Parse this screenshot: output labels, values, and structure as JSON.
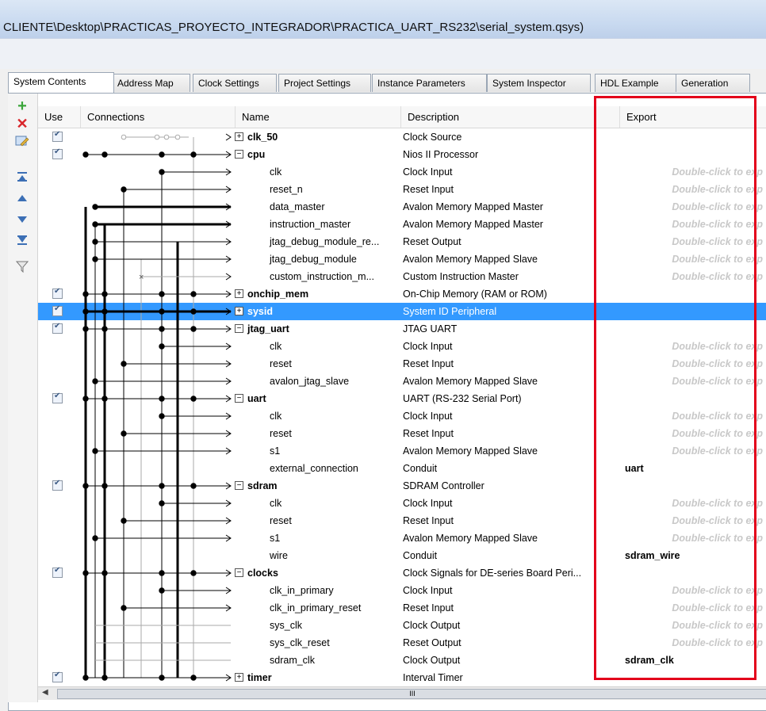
{
  "window": {
    "title": "CLIENTE\\Desktop\\PRACTICAS_PROYECTO_INTEGRADOR\\PRACTICA_UART_RS232\\serial_system.qsys)"
  },
  "tabs": [
    {
      "label": "System Contents"
    },
    {
      "label": "Address Map"
    },
    {
      "label": "Clock Settings"
    },
    {
      "label": "Project Settings"
    },
    {
      "label": "Instance Parameters"
    },
    {
      "label": "System Inspector"
    },
    {
      "label": "HDL Example"
    },
    {
      "label": "Generation"
    }
  ],
  "toolbar": {
    "icons": [
      "add-icon",
      "remove-icon",
      "edit-icon",
      "move-top-icon",
      "move-up-icon",
      "move-down-icon",
      "move-bottom-icon",
      "filter-icon"
    ],
    "colors": {
      "add": "#3aa53a",
      "remove": "#d9262b",
      "arrows": "#3c6fb5"
    }
  },
  "columns": {
    "use": "Use",
    "connections": "Connections",
    "name": "Name",
    "description": "Description",
    "export": "Export"
  },
  "rows": [
    {
      "type": "main",
      "expanded": false,
      "name": "clk_50",
      "desc": "Clock Source",
      "export": ""
    },
    {
      "type": "main",
      "expanded": true,
      "name": "cpu",
      "desc": "Nios II Processor",
      "export": ""
    },
    {
      "type": "sub",
      "name": "clk",
      "desc": "Clock Input",
      "export": "Double-click to exp"
    },
    {
      "type": "sub",
      "name": "reset_n",
      "desc": "Reset Input",
      "export": "Double-click to exp"
    },
    {
      "type": "sub",
      "name": "data_master",
      "desc": "Avalon Memory Mapped Master",
      "export": "Double-click to exp"
    },
    {
      "type": "sub",
      "name": "instruction_master",
      "desc": "Avalon Memory Mapped Master",
      "export": "Double-click to exp"
    },
    {
      "type": "sub",
      "name": "jtag_debug_module_re...",
      "desc": "Reset Output",
      "export": "Double-click to exp"
    },
    {
      "type": "sub",
      "name": "jtag_debug_module",
      "desc": "Avalon Memory Mapped Slave",
      "export": "Double-click to exp"
    },
    {
      "type": "sub",
      "name": "custom_instruction_m...",
      "desc": "Custom Instruction Master",
      "export": "Double-click to exp"
    },
    {
      "type": "main",
      "expanded": false,
      "name": "onchip_mem",
      "desc": "On-Chip Memory (RAM or ROM)",
      "export": ""
    },
    {
      "type": "main",
      "expanded": false,
      "selected": true,
      "name": "sysid",
      "desc": "System ID Peripheral",
      "export": ""
    },
    {
      "type": "main",
      "expanded": true,
      "name": "jtag_uart",
      "desc": "JTAG UART",
      "export": ""
    },
    {
      "type": "sub",
      "name": "clk",
      "desc": "Clock Input",
      "export": "Double-click to exp"
    },
    {
      "type": "sub",
      "name": "reset",
      "desc": "Reset Input",
      "export": "Double-click to exp"
    },
    {
      "type": "sub",
      "name": "avalon_jtag_slave",
      "desc": "Avalon Memory Mapped Slave",
      "export": "Double-click to exp"
    },
    {
      "type": "main",
      "expanded": true,
      "name": "uart",
      "desc": "UART (RS-232 Serial Port)",
      "export": ""
    },
    {
      "type": "sub",
      "name": "clk",
      "desc": "Clock Input",
      "export": "Double-click to exp"
    },
    {
      "type": "sub",
      "name": "reset",
      "desc": "Reset Input",
      "export": "Double-click to exp"
    },
    {
      "type": "sub",
      "name": "s1",
      "desc": "Avalon Memory Mapped Slave",
      "export": "Double-click to exp"
    },
    {
      "type": "sub",
      "name": "external_connection",
      "desc": "Conduit",
      "export": "uart"
    },
    {
      "type": "main",
      "expanded": true,
      "name": "sdram",
      "desc": "SDRAM Controller",
      "export": ""
    },
    {
      "type": "sub",
      "name": "clk",
      "desc": "Clock Input",
      "export": "Double-click to exp"
    },
    {
      "type": "sub",
      "name": "reset",
      "desc": "Reset Input",
      "export": "Double-click to exp"
    },
    {
      "type": "sub",
      "name": "s1",
      "desc": "Avalon Memory Mapped Slave",
      "export": "Double-click to exp"
    },
    {
      "type": "sub",
      "name": "wire",
      "desc": "Conduit",
      "export": "sdram_wire"
    },
    {
      "type": "main",
      "expanded": true,
      "name": "clocks",
      "desc": "Clock Signals for DE-series Board Peri...",
      "export": ""
    },
    {
      "type": "sub",
      "name": "clk_in_primary",
      "desc": "Clock Input",
      "export": "Double-click to exp"
    },
    {
      "type": "sub",
      "name": "clk_in_primary_reset",
      "desc": "Reset Input",
      "export": "Double-click to exp"
    },
    {
      "type": "sub",
      "name": "sys_clk",
      "desc": "Clock Output",
      "export": "Double-click to exp"
    },
    {
      "type": "sub",
      "name": "sys_clk_reset",
      "desc": "Reset Output",
      "export": "Double-click to exp"
    },
    {
      "type": "sub",
      "name": "sdram_clk",
      "desc": "Clock Output",
      "export": "sdram_clk"
    },
    {
      "type": "main",
      "expanded": false,
      "name": "timer",
      "desc": "Interval Timer",
      "export": ""
    }
  ],
  "scrollbar": {
    "grip": "III"
  },
  "highlight": {
    "color": "#e3001b",
    "selection": "#3399ff"
  }
}
